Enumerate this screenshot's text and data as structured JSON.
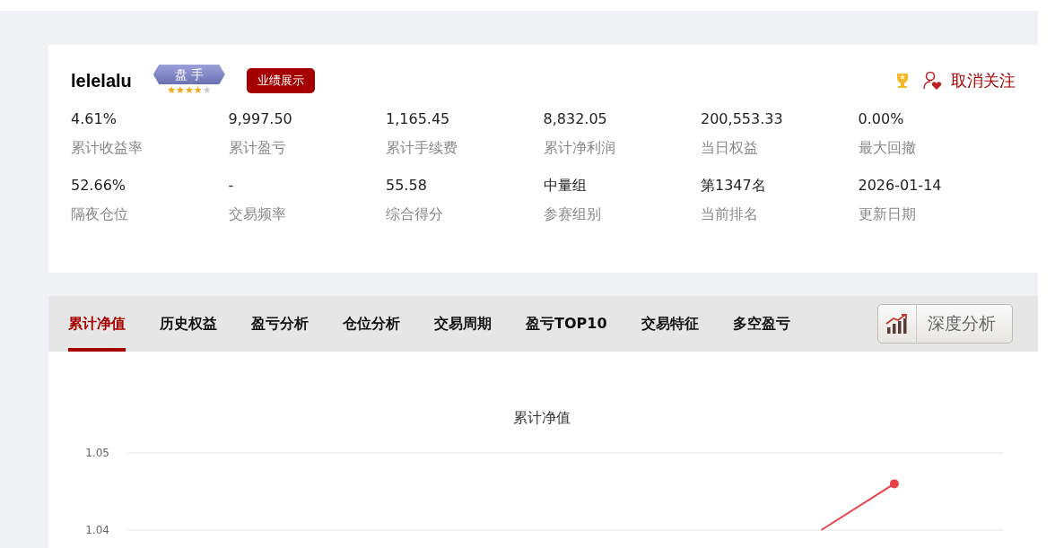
{
  "profile": {
    "username": "lelelalu",
    "badge": {
      "label": "盘 手",
      "stars": 4
    },
    "tag": "业绩展示",
    "follow_button": "取消关注"
  },
  "stats": [
    {
      "value": "4.61%",
      "label": "累计收益率"
    },
    {
      "value": "9,997.50",
      "label": "累计盈亏"
    },
    {
      "value": "1,165.45",
      "label": "累计手续费"
    },
    {
      "value": "8,832.05",
      "label": "累计净利润"
    },
    {
      "value": "200,553.33",
      "label": "当日权益"
    },
    {
      "value": "0.00%",
      "label": "最大回撤"
    },
    {
      "value": "52.66%",
      "label": "隔夜仓位"
    },
    {
      "value": "-",
      "label": "交易频率"
    },
    {
      "value": "55.58",
      "label": "综合得分"
    },
    {
      "value": "中量组",
      "label": "参赛组别"
    },
    {
      "value": "第1347名",
      "label": "当前排名"
    },
    {
      "value": "2026-01-14",
      "label": "更新日期"
    }
  ],
  "tabs": [
    {
      "label": "累计净值",
      "selected": true
    },
    {
      "label": "历史权益",
      "selected": false
    },
    {
      "label": "盈亏分析",
      "selected": false
    },
    {
      "label": "仓位分析",
      "selected": false
    },
    {
      "label": "交易周期",
      "selected": false
    },
    {
      "label": "盈亏TOP10",
      "selected": false
    },
    {
      "label": "交易特征",
      "selected": false
    },
    {
      "label": "多空盈亏",
      "selected": false
    }
  ],
  "analysis_button": "深度分析",
  "chart_data": {
    "type": "line",
    "title": "累计净值",
    "categories": [
      null,
      null,
      null,
      null,
      null,
      null,
      null,
      null,
      null,
      null,
      null,
      null
    ],
    "ylim": [
      1.04,
      1.05
    ],
    "yticks": [
      1.04,
      1.05
    ],
    "series": [
      {
        "color": "#e8434a",
        "values": [
          null,
          null,
          null,
          null,
          null,
          null,
          null,
          null,
          null,
          1.04,
          1.046,
          null
        ]
      }
    ]
  }
}
